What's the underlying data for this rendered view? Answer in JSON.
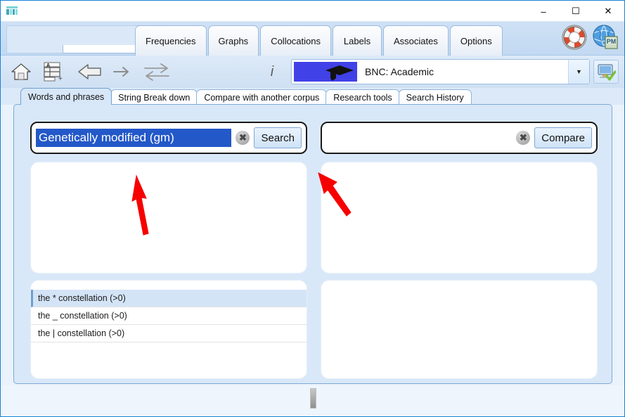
{
  "window": {
    "app_icon": "app-icon",
    "minimize": "–",
    "maximize": "☐",
    "close": "✕"
  },
  "ribbon": {
    "tabs": [
      {
        "label": "Frequencies"
      },
      {
        "label": "Graphs"
      },
      {
        "label": "Collocations"
      },
      {
        "label": "Labels"
      },
      {
        "label": "Associates"
      },
      {
        "label": "Options"
      }
    ],
    "icons": [
      {
        "name": "help-lifebuoy-icon"
      },
      {
        "name": "globe-pm-icon"
      }
    ]
  },
  "toolbar": {
    "icons": [
      {
        "name": "home-icon"
      },
      {
        "name": "new-table-icon"
      },
      {
        "name": "back-arrow-icon"
      },
      {
        "name": "forward-arrow-icon"
      },
      {
        "name": "swap-arrows-icon"
      },
      {
        "name": "info-icon"
      }
    ],
    "info_glyph": "i",
    "corpus": {
      "label": "BNC: Academic",
      "swatch_color": "#4141e8",
      "dropdown_glyph": "▼"
    },
    "monitor_button": "monitor-check-icon"
  },
  "main_tabs": [
    {
      "label": "Words and phrases",
      "active": true
    },
    {
      "label": "String Break down",
      "active": false
    },
    {
      "label": "Compare with another corpus",
      "active": false
    },
    {
      "label": "Research tools",
      "active": false
    },
    {
      "label": "Search History",
      "active": false
    }
  ],
  "left_panel": {
    "search": {
      "value": "Genetically modified (gm)",
      "placeholder": "",
      "selected": true,
      "clear_glyph": "✖",
      "button_label": "Search"
    },
    "suggestions": [
      {
        "label": "the * constellation (>0)",
        "selected": true
      },
      {
        "label": "the _ constellation (>0)",
        "selected": false
      },
      {
        "label": "the | constellation (>0)",
        "selected": false
      }
    ]
  },
  "right_panel": {
    "search": {
      "value": "",
      "placeholder": "",
      "clear_glyph": "✖",
      "button_label": "Compare"
    }
  },
  "annotations": {
    "arrow_color": "#f60000",
    "arrows": [
      {
        "name": "arrow-pointing-left-results-panel"
      },
      {
        "name": "arrow-pointing-right-results-panel"
      }
    ]
  },
  "bottom": {
    "splitter": "horizontal-splitter-handle"
  }
}
